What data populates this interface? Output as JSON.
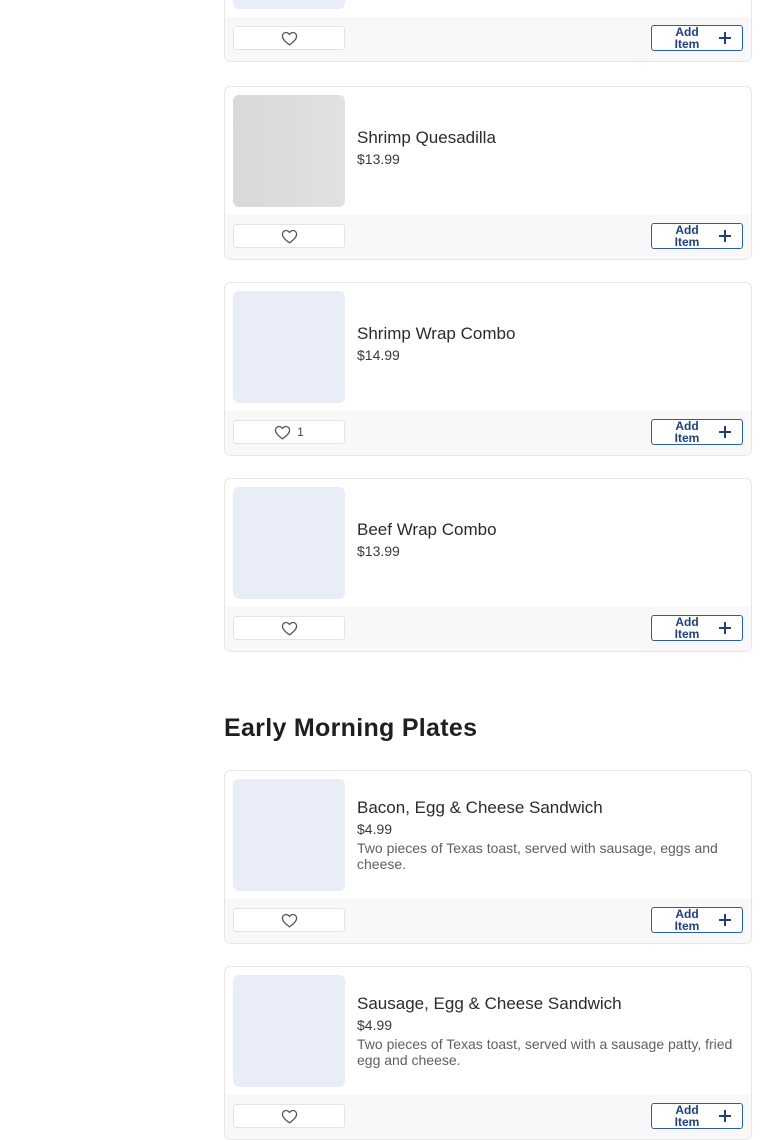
{
  "add_item_label": "Add Item",
  "colors": {
    "accent_border": "#2b5ca8",
    "accent_text": "#1f3f77",
    "placeholder_thumb": "#e8edf7"
  },
  "icons": {
    "favorite": "heart-outline-icon",
    "add": "plus-icon"
  },
  "items_top": [
    {
      "name": "",
      "price": "",
      "likes": ""
    },
    {
      "name": "Shrimp Quesadilla",
      "price": "$13.99",
      "likes": ""
    },
    {
      "name": "Shrimp Wrap Combo",
      "price": "$14.99",
      "likes": "1"
    },
    {
      "name": "Beef Wrap Combo",
      "price": "$13.99",
      "likes": ""
    }
  ],
  "section": {
    "title": "Early Morning Plates",
    "items": [
      {
        "name": "Bacon, Egg & Cheese Sandwich",
        "price": "$4.99",
        "description": "Two pieces of Texas toast, served with sausage, eggs and cheese.",
        "likes": ""
      },
      {
        "name": "Sausage, Egg & Cheese Sandwich",
        "price": "$4.99",
        "description": "Two pieces of Texas toast, served with a sausage patty, fried egg and cheese.",
        "likes": ""
      }
    ]
  }
}
